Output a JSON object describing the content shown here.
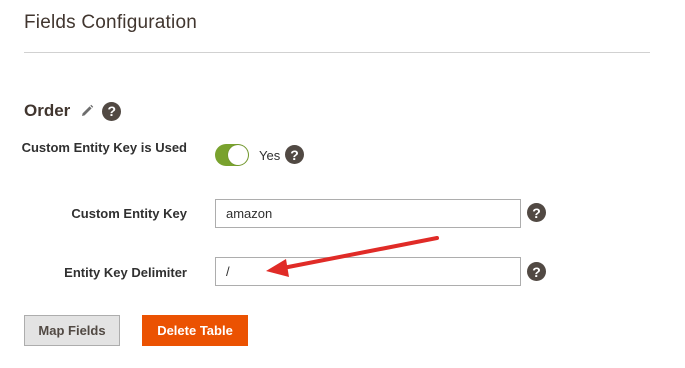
{
  "page": {
    "title": "Fields Configuration"
  },
  "section": {
    "title": "Order"
  },
  "fields": {
    "custom_entity_key_used": {
      "label": "Custom Entity Key is Used",
      "value": "Yes",
      "enabled": true
    },
    "custom_entity_key": {
      "label": "Custom Entity Key",
      "value": "amazon"
    },
    "entity_key_delimiter": {
      "label": "Entity Key Delimiter",
      "value": "/"
    }
  },
  "help_glyph": "?",
  "buttons": {
    "map_fields": "Map Fields",
    "delete_table": "Delete Table"
  },
  "colors": {
    "toggle_on": "#79a22e",
    "primary_button": "#eb5202",
    "annotation_arrow": "#e02b27",
    "help_icon": "#514943"
  },
  "icons": [
    "pencil-icon",
    "help-icon"
  ]
}
